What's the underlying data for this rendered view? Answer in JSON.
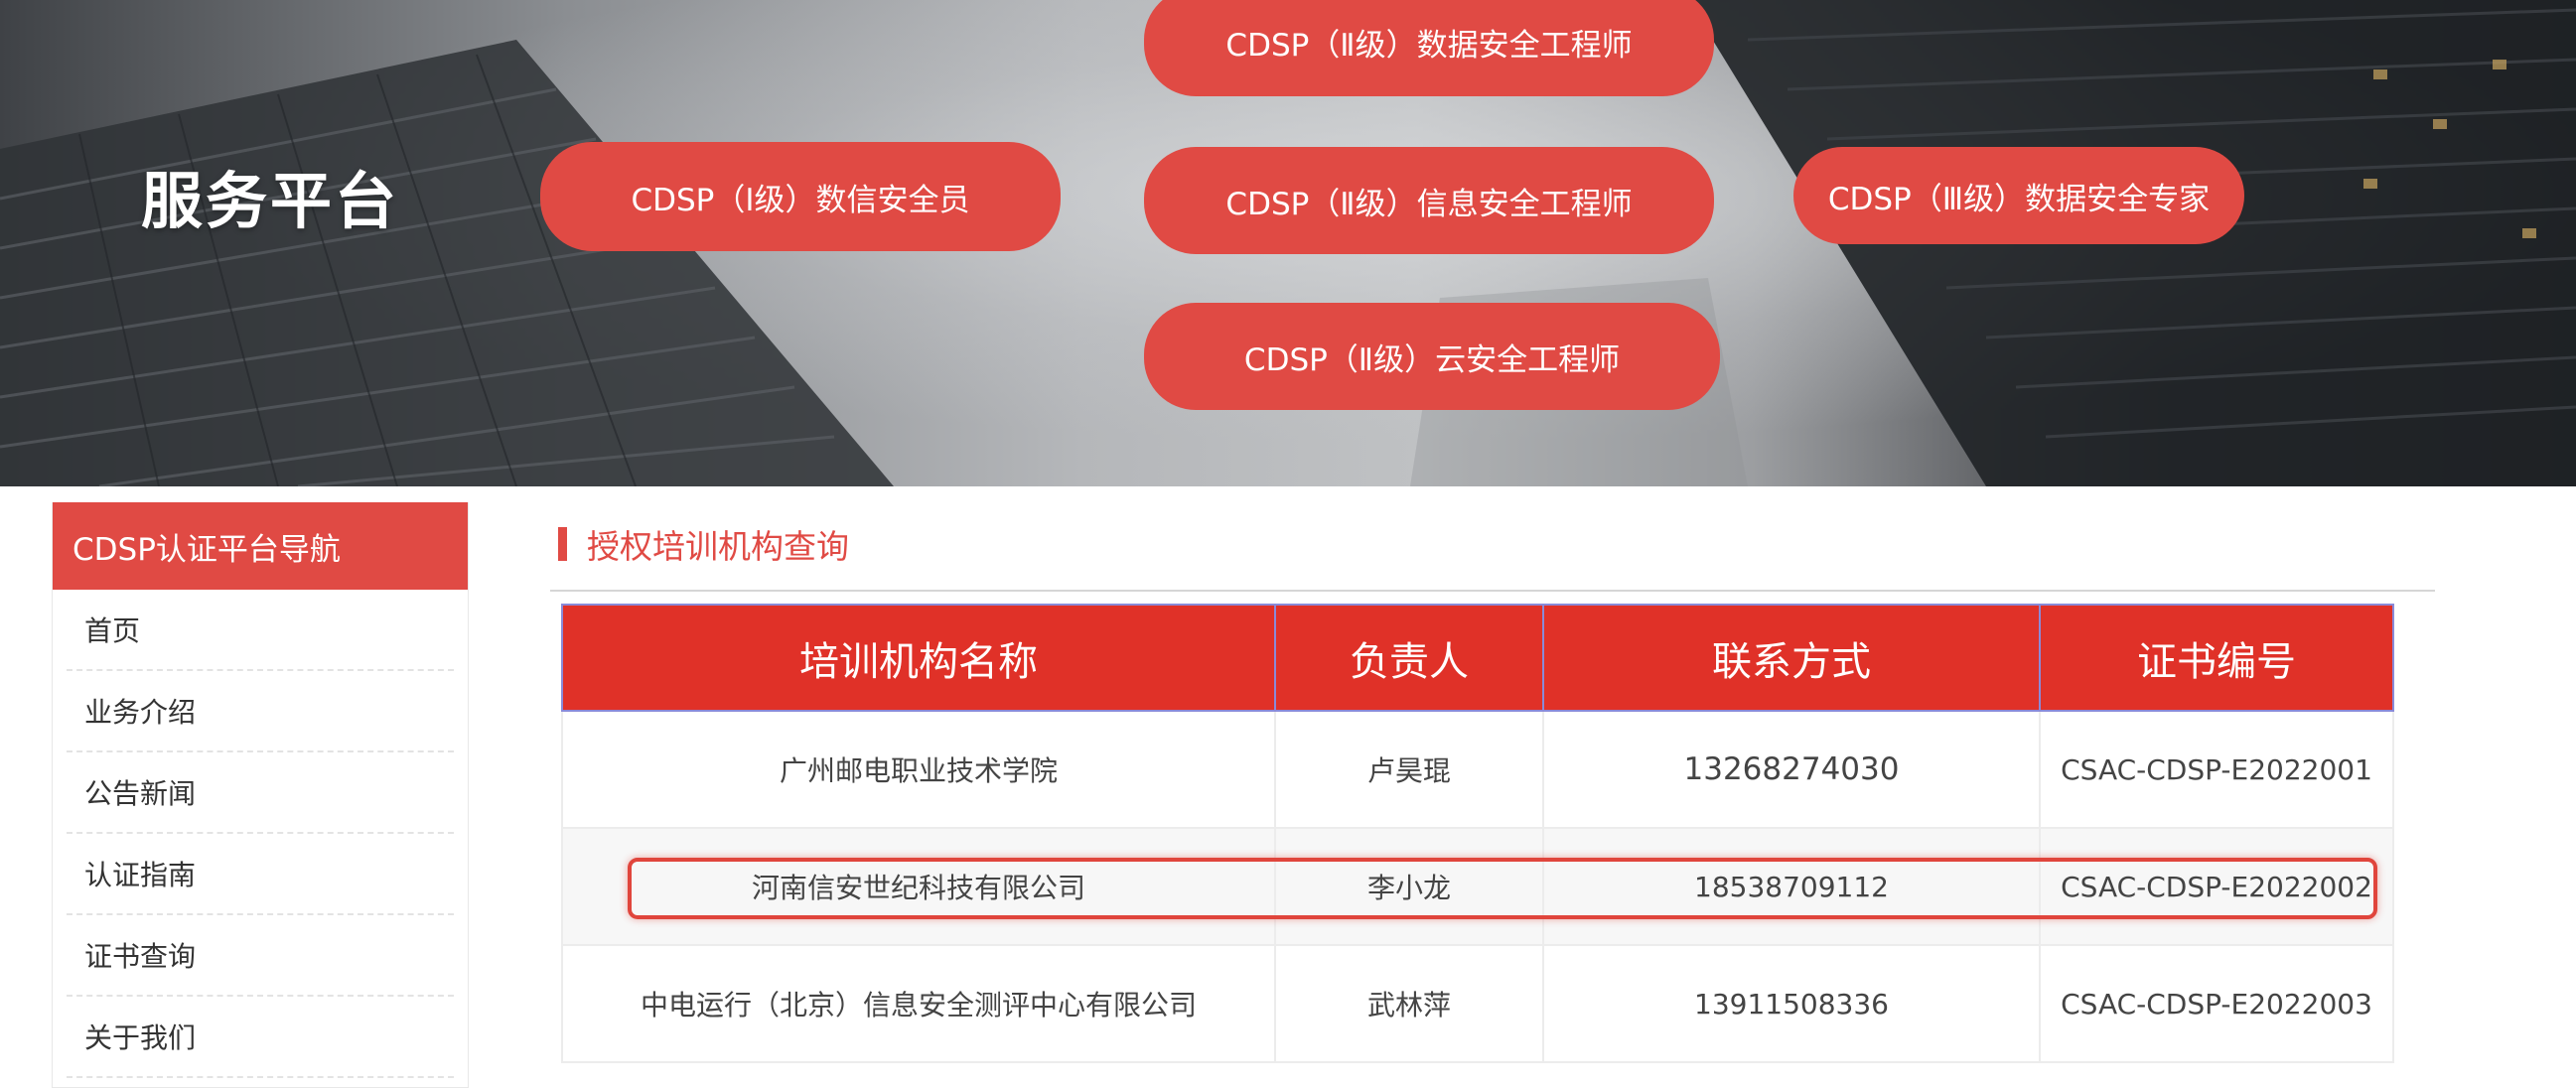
{
  "banner": {
    "title": "服务平台",
    "buttons": [
      {
        "id": "l1",
        "label": "CDSP（Ⅰ级）数信安全员"
      },
      {
        "id": "l2a",
        "label": "CDSP（Ⅱ级）数据安全工程师"
      },
      {
        "id": "l2b",
        "label": "CDSP（Ⅱ级）信息安全工程师"
      },
      {
        "id": "l3",
        "label": "CDSP（Ⅲ级）数据安全专家"
      },
      {
        "id": "l2c",
        "label": "CDSP（Ⅱ级）云安全工程师"
      }
    ]
  },
  "sidebar": {
    "title": "CDSP认证平台导航",
    "items": [
      {
        "label": "首页"
      },
      {
        "label": "业务介绍"
      },
      {
        "label": "公告新闻"
      },
      {
        "label": "认证指南"
      },
      {
        "label": "证书查询"
      },
      {
        "label": "关于我们"
      }
    ]
  },
  "main": {
    "section_title": "授权培训机构查询",
    "table": {
      "headers": [
        "培训机构名称",
        "负责人",
        "联系方式",
        "证书编号"
      ],
      "rows": [
        {
          "name": "广州邮电职业技术学院",
          "person": "卢昊琨",
          "phone": "13268274030",
          "cert": "CSAC-CDSP-E2022001"
        },
        {
          "name": "河南信安世纪科技有限公司",
          "person": "李小龙",
          "phone": "18538709112",
          "cert": "CSAC-CDSP-E2022002"
        },
        {
          "name": "中电运行（北京）信息安全测评中心有限公司",
          "person": "武林萍",
          "phone": "13911508336",
          "cert": "CSAC-CDSP-E2022003"
        }
      ]
    }
  },
  "colors": {
    "accent": "#e04a44",
    "table_header": "#e03128"
  }
}
